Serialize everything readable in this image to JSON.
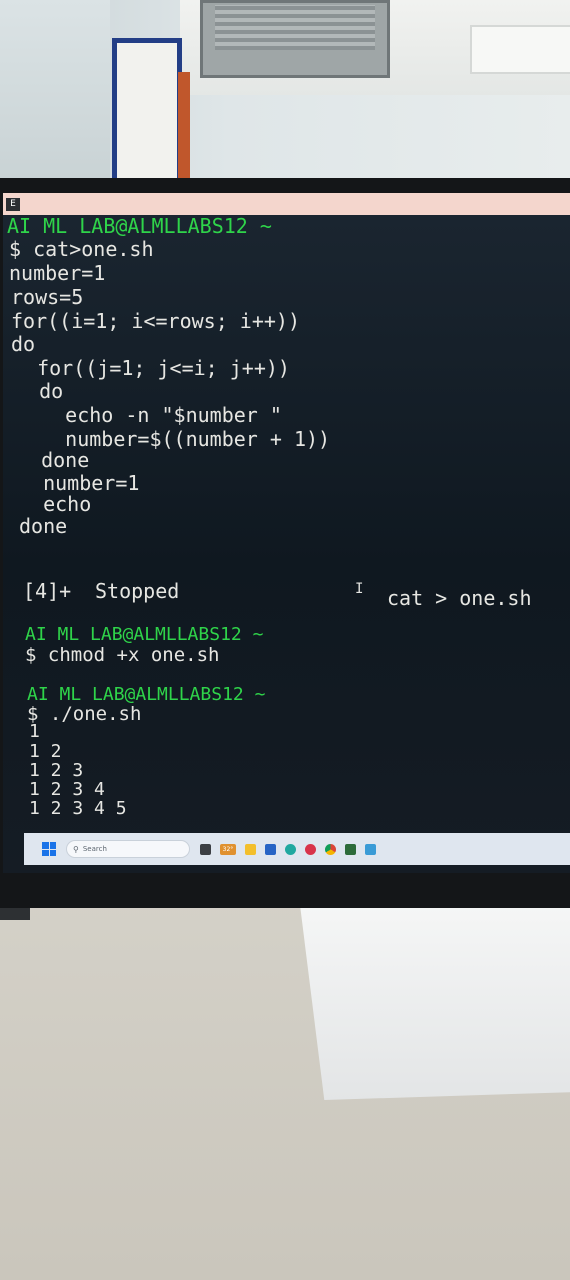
{
  "terminal": {
    "prompt1": "AI ML LAB@ALMLLABS12 ~",
    "cmd1": "$ cat>one.sh",
    "script_lines": [
      "number=1",
      "rows=5",
      "for((i=1; i<=rows; i++))",
      "do",
      "  for((j=1; j<=i; j++))",
      "  do",
      "    echo -n \"$number \"",
      "    number=$((number + 1))",
      "  done",
      "  number=1",
      "  echo",
      "done"
    ],
    "job_id": "[4]+",
    "job_state": "Stopped",
    "job_cmd": "cat > one.sh",
    "cursor_glyph": "I",
    "prompt2": "AI ML LAB@ALMLLABS12 ~",
    "cmd2": "$ chmod +x one.sh",
    "prompt3": "AI ML LAB@ALMLLABS12 ~",
    "cmd3": "$ ./one.sh",
    "output_lines": [
      "1",
      "1 2",
      "1 2 3",
      "1 2 3 4",
      "1 2 3 4 5"
    ]
  },
  "taskbar": {
    "search_placeholder": "Search",
    "weather": "32°"
  },
  "colors": {
    "prompt_green": "#2fd44a",
    "text": "#e6e6e2",
    "titlebar": "#f4d6cd",
    "windows_blue": "#1a73e8"
  },
  "icons": [
    "windows-start-icon",
    "search-icon",
    "file-explorer-icon",
    "edge-icon",
    "chrome-icon",
    "terminal-icon"
  ]
}
